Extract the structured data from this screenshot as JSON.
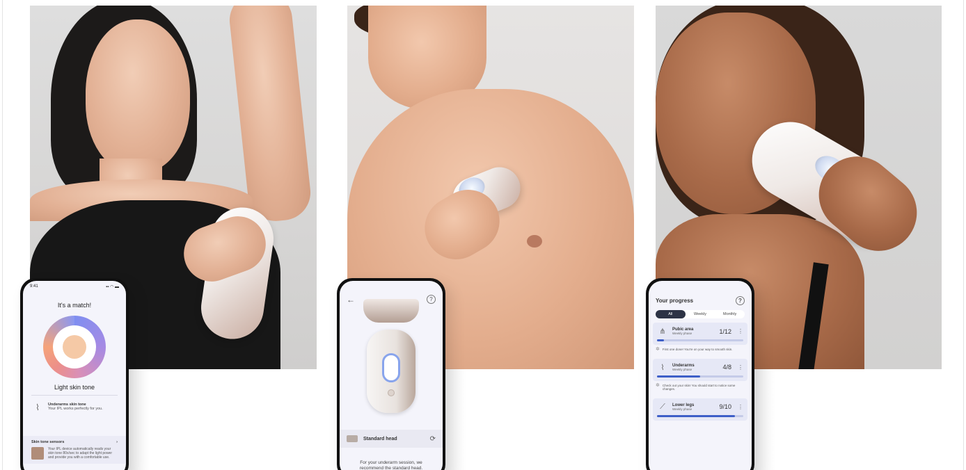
{
  "phone1": {
    "status_time": "9:41",
    "status_icons": "▪▪ ◠ ▬",
    "title": "It's a match!",
    "tone_label": "Light skin tone",
    "underarms_title": "Underarms skin tone",
    "underarms_text": "Your IPL works perfectly for you.",
    "sensors_title": "Skin tone sensors",
    "sensors_arrow": "›",
    "sensors_text": "Your IPL device automatically reads your skin tone 80x/sec to adapt the light power and provide you with a comfortable use."
  },
  "phone2": {
    "back": "←",
    "help": "?",
    "head_label": "Standard head",
    "refresh": "⟳",
    "recommendation": "For your underarm session, we recommend the standard head."
  },
  "phone3": {
    "title": "Your progress",
    "help": "?",
    "tabs": [
      "All",
      "Weekly",
      "Monthly"
    ],
    "areas": [
      {
        "name": "Pubic area",
        "phase": "Weekly phase",
        "count": "1/12",
        "progress": 0.08,
        "icon": "pubic-area-icon"
      },
      {
        "name": "Underarms",
        "phase": "Weekly phase",
        "count": "4/8",
        "progress": 0.5,
        "icon": "underarms-icon"
      },
      {
        "name": "Lower legs",
        "phase": "Weekly phase",
        "count": "9/10",
        "progress": 0.9,
        "icon": "lower-legs-icon"
      }
    ],
    "tips": [
      "First one done! You're on your way to smooth skin.",
      "Check out your skin! You should start to notice some changes."
    ]
  },
  "colors": {
    "accent": "#3e5fc8",
    "dark_tab": "#2d3345",
    "screen_bg": "#f4f4fb"
  }
}
